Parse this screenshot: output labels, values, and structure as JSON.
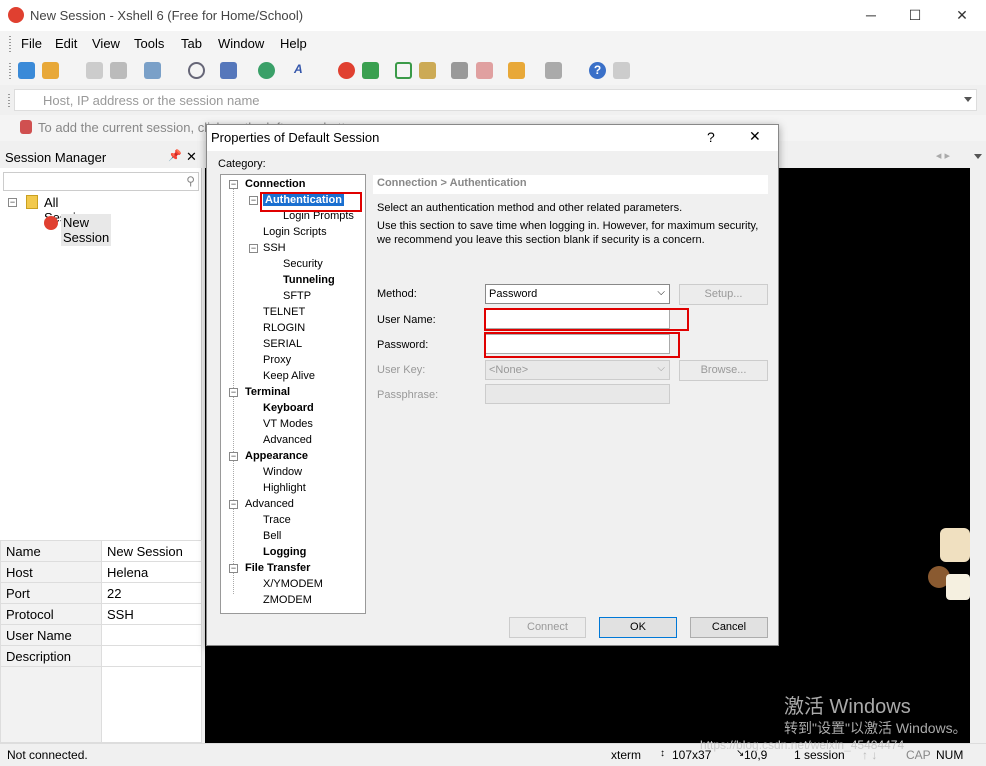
{
  "window": {
    "title": "New Session - Xshell 6 (Free for Home/School)"
  },
  "menu": [
    "File",
    "Edit",
    "View",
    "Tools",
    "Tab",
    "Window",
    "Help"
  ],
  "address": {
    "placeholder": "Host, IP address or the session name"
  },
  "hint": {
    "text": "To add the current session, click on the left arrow button."
  },
  "session_manager": {
    "title": "Session Manager",
    "tree": {
      "root": "All Sessions",
      "child": "New Session"
    },
    "props": [
      {
        "key": "Name",
        "value": "New Session"
      },
      {
        "key": "Host",
        "value": "Helena"
      },
      {
        "key": "Port",
        "value": "22"
      },
      {
        "key": "Protocol",
        "value": "SSH"
      },
      {
        "key": "User Name",
        "value": ""
      },
      {
        "key": "Description",
        "value": ""
      }
    ]
  },
  "dialog": {
    "title": "Properties of Default Session",
    "help": "?",
    "close": "✕",
    "category_label": "Category:",
    "tree": {
      "connection": "Connection",
      "authentication": "Authentication",
      "login_prompts": "Login Prompts",
      "login_scripts": "Login Scripts",
      "ssh": "SSH",
      "security": "Security",
      "tunneling": "Tunneling",
      "sftp": "SFTP",
      "telnet": "TELNET",
      "rlogin": "RLOGIN",
      "serial": "SERIAL",
      "proxy": "Proxy",
      "keep_alive": "Keep Alive",
      "terminal": "Terminal",
      "keyboard": "Keyboard",
      "vt_modes": "VT Modes",
      "advanced_t": "Advanced",
      "appearance": "Appearance",
      "window": "Window",
      "highlight": "Highlight",
      "advanced": "Advanced",
      "trace": "Trace",
      "bell": "Bell",
      "logging": "Logging",
      "file_transfer": "File Transfer",
      "xymodem": "X/YMODEM",
      "zmodem": "ZMODEM"
    },
    "panel_header": "Connection > Authentication",
    "desc1": "Select an authentication method and other related parameters.",
    "desc2": "Use this section to save time when logging in. However, for maximum security,",
    "desc3": "we recommend you leave this section blank if security is a concern.",
    "method_label": "Method:",
    "method_value": "Password",
    "setup": "Setup...",
    "username_label": "User Name:",
    "password_label": "Password:",
    "userkey_label": "User Key:",
    "userkey_value": "<None>",
    "browse": "Browse...",
    "passphrase_label": "Passphrase:",
    "connect": "Connect",
    "ok": "OK",
    "cancel": "Cancel"
  },
  "status": {
    "left": "Not connected.",
    "term": "xterm",
    "size": "107x37",
    "pos": "10,9",
    "sessions": "1 session",
    "cap": "CAP",
    "num": "NUM"
  },
  "watermark": {
    "line1": "激活 Windows",
    "line2": "转到\"设置\"以激活 Windows。",
    "line3": "https://blog.csdn.net/weixin_45484474"
  },
  "colors": {
    "accent": "#1a6fd0",
    "highlight": "#e00000"
  }
}
